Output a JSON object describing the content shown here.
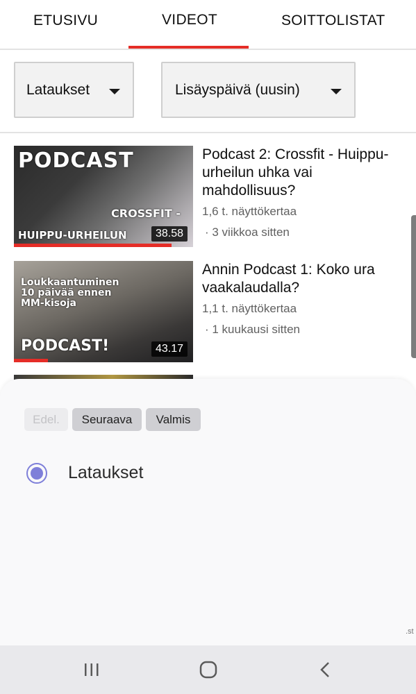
{
  "tabs": [
    {
      "label": "ETUSIVU"
    },
    {
      "label": "VIDEOT",
      "active": true
    },
    {
      "label": "SOITTOLISTAT"
    }
  ],
  "filters": {
    "type": {
      "selected": "Lataukset"
    },
    "sort": {
      "selected": "Lisäyspäivä (uusin)"
    }
  },
  "videos": [
    {
      "title": "Podcast 2: Crossfit - Huippu-urheilun uhka vai mahdollisuus?",
      "views": "1,6 t. näyttökertaa",
      "age": "· 3 viikkoa sitten",
      "duration": "38.58",
      "thumb_text": [
        "PODCAST",
        "CROSSFIT -",
        "HUIPPU-URHEILUN"
      ],
      "watched_fraction": 0.88
    },
    {
      "title": "Annin Podcast 1: Koko ura vaakalaudalla?",
      "views": "1,1 t. näyttökertaa",
      "age": "· 1 kuukausi sitten",
      "duration": "43.17",
      "thumb_text": [
        "Loukkaantuminen 10 päivää ennen MM-kisoja",
        "PODCAST!"
      ],
      "watched_fraction": 0.19
    }
  ],
  "sheet": {
    "prev_label": "Edel.",
    "next_label": "Seuraava",
    "done_label": "Valmis",
    "option_label": "Lataukset",
    "option_selected": true
  },
  "edge_text": ".st",
  "colors": {
    "accent_red": "#e52d27",
    "radio": "#7e7fd9",
    "sheet_bg": "#f9f9fa",
    "navbar_bg": "#e9e9ec"
  },
  "navbar": {
    "icons": [
      "recent-apps-icon",
      "home-icon",
      "back-icon"
    ]
  }
}
